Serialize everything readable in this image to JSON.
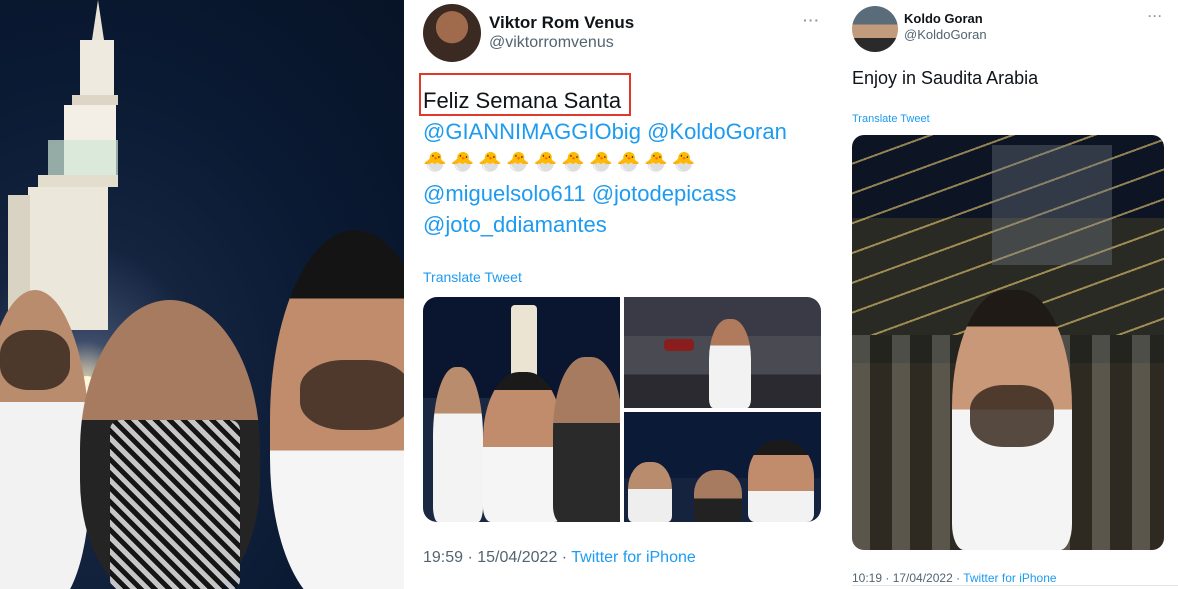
{
  "tweet1": {
    "display_name": "Viktor Rom Venus",
    "handle": "@viktorromvenus",
    "more_label": "···",
    "text": "Feliz Semana Santa",
    "mentions_line1": [
      "@GIANNIMAGGIObig",
      "@KoldoGoran"
    ],
    "emojis": "🐣🐣🐣🐣🐣🐣🐣🐣🐣🐣",
    "mentions_line2": [
      "@miguelsolo611",
      "@jotodepicass"
    ],
    "mentions_line3": [
      "@joto_ddiamantes"
    ],
    "translate_label": "Translate Tweet",
    "timestamp": "19:59 · 15/04/2022 · ",
    "source": "Twitter for iPhone"
  },
  "tweet2": {
    "display_name": "Koldo Goran",
    "handle": "@KoldoGoran",
    "more_label": "···",
    "text": "Enjoy in Saudita Arabia",
    "translate_label": "Translate Tweet",
    "timestamp": "10:19 · 17/04/2022 · ",
    "source": "Twitter for iPhone"
  },
  "colors": {
    "link": "#1d9bf0",
    "highlight": "#e0392b",
    "secondary_text": "#536471"
  }
}
